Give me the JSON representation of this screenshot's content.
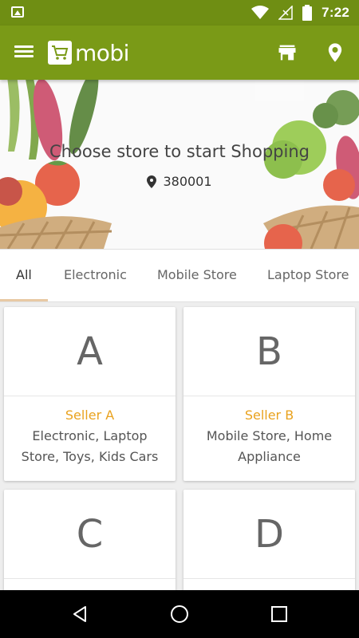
{
  "status_bar": {
    "time": "7:22",
    "icons": [
      "image-notification-icon",
      "wifi-icon",
      "signal-icon",
      "battery-icon"
    ]
  },
  "app_bar": {
    "logo_text": "mobi",
    "icons": [
      "menu-icon",
      "cart-logo-icon",
      "store-icon",
      "location-pin-icon"
    ],
    "color": "#7a9a17"
  },
  "hero": {
    "title": "Choose store to start Shopping",
    "pincode": "380001"
  },
  "tabs": [
    {
      "label": "All",
      "active": true
    },
    {
      "label": "Electronic",
      "active": false
    },
    {
      "label": "Mobile Store",
      "active": false
    },
    {
      "label": "Laptop Store",
      "active": false
    }
  ],
  "stores": [
    {
      "letter": "A",
      "name": "Seller A",
      "categories": "Electronic, Laptop Store, Toys, Kids Cars"
    },
    {
      "letter": "B",
      "name": "Seller B",
      "categories": "Mobile Store, Home Appliance"
    },
    {
      "letter": "C",
      "name": "",
      "categories": ""
    },
    {
      "letter": "D",
      "name": "",
      "categories": ""
    }
  ],
  "accent_color": "#e9a21e",
  "nav_bar": {
    "icons": [
      "back-icon",
      "home-icon",
      "recents-icon"
    ]
  }
}
